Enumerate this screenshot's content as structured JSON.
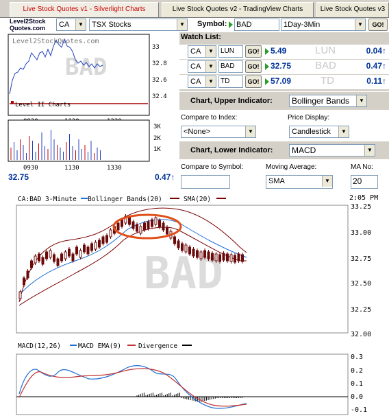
{
  "tabs": [
    {
      "label": "Live Stock Quotes v1 - Silverlight Charts",
      "active": true
    },
    {
      "label": "Live Stock Quotes v2 - TradingView Charts",
      "active": false
    },
    {
      "label": "Live Stock Quotes v3",
      "active": false
    }
  ],
  "logo": {
    "line1": "Level2Stock",
    "line2": "Quotes.com"
  },
  "toolbar": {
    "country": "CA",
    "exchange": "TSX Stocks",
    "symbol_label": "Symbol:",
    "symbol_value": "BAD",
    "period": "1Day-3Min",
    "go_label": "GO!"
  },
  "mini_chart": {
    "watermark": "BAD",
    "brand": "Level2StockQuotes.com",
    "level2_link": "Level II Charts",
    "price_ticks": [
      "33",
      "32.8",
      "32.6",
      "32.4"
    ],
    "volume_ticks": [
      "3K",
      "2K",
      "1K"
    ],
    "time_ticks": [
      "0930",
      "1130",
      "1330"
    ],
    "last_price": "32.75",
    "change": "0.47",
    "up_arrow": "↑"
  },
  "watchlist": {
    "title": "Watch List:",
    "go_label": "GO!",
    "items": [
      {
        "country": "CA",
        "symbol": "LUN",
        "price": "5.49",
        "change": "0.04"
      },
      {
        "country": "CA",
        "symbol": "BAD",
        "price": "32.75",
        "change": "0.47"
      },
      {
        "country": "CA",
        "symbol": "TD",
        "price": "57.09",
        "change": "0.11"
      }
    ]
  },
  "settings": {
    "upper_label": "Chart, Upper Indicator:",
    "upper_value": "Bollinger Bands",
    "compare_index_label": "Compare to Index:",
    "compare_index_value": "<None>",
    "price_display_label": "Price Display:",
    "price_display_value": "Candlestick",
    "lower_label": "Chart, Lower Indicator:",
    "lower_value": "MACD",
    "compare_symbol_label": "Compare to Symbol:",
    "compare_symbol_value": "",
    "moving_avg_label": "Moving Average:",
    "moving_avg_value": "SMA",
    "ma_no_label": "MA No:",
    "ma_no_value": "20"
  },
  "main_chart": {
    "header": "CA:BAD 3-Minute",
    "legend_bb": "Bollinger Bands(20)",
    "legend_sma": "SMA(20)",
    "time": "2:05 PM",
    "watermark": "BAD",
    "y_ticks": [
      "33.25",
      "33.00",
      "32.75",
      "32.50",
      "32.25",
      "32.00"
    ],
    "colors": {
      "candle": "#6b0a0a",
      "band": "#7a0000",
      "highlight": "#e0501a",
      "blue": "#1f6fd6"
    }
  },
  "macd_chart": {
    "label": "MACD(12,26)",
    "legend_ema": "MACD EMA(9)",
    "legend_div": "Divergence",
    "y_ticks": [
      "0.3",
      "0.2",
      "0.1",
      "0.0",
      "-0.1"
    ]
  }
}
